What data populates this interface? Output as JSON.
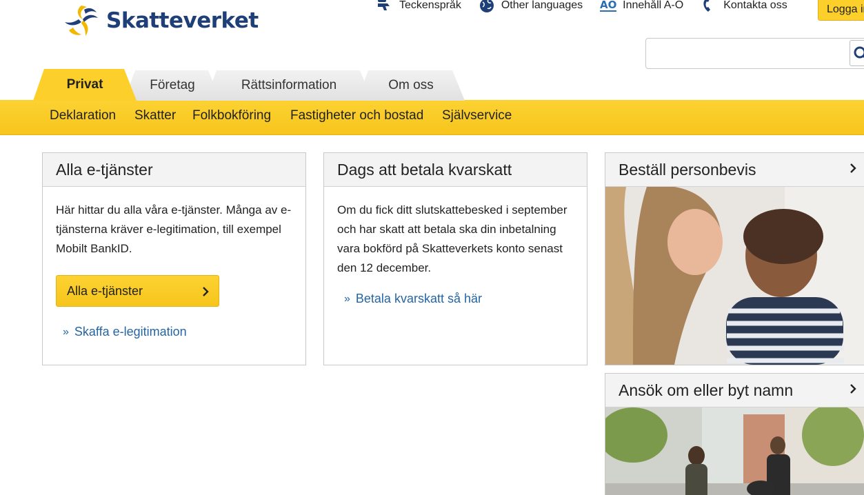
{
  "brand": {
    "name": "Skatteverket"
  },
  "toplinks": [
    {
      "label": "Teckenspråk",
      "icon": "sign-language-icon"
    },
    {
      "label": "Other languages",
      "icon": "globe-icon"
    },
    {
      "label": "Innehåll A-Ö",
      "icon": "a-o-icon"
    },
    {
      "label": "Kontakta oss",
      "icon": "phone-icon"
    }
  ],
  "login": {
    "label": "Logga in"
  },
  "search": {
    "placeholder": ""
  },
  "tabs": [
    {
      "label": "Privat",
      "active": true
    },
    {
      "label": "Företag",
      "active": false
    },
    {
      "label": "Rättsinformation",
      "active": false
    },
    {
      "label": "Om oss",
      "active": false
    }
  ],
  "subnav": [
    "Deklaration",
    "Skatter",
    "Folkbokföring",
    "Fastigheter och bostad",
    "Självservice"
  ],
  "cards": {
    "etjanster": {
      "title": "Alla e-tjänster",
      "body": "Här hittar du alla våra e-tjänster. Många av e-tjänsterna kräver e-legitimation, till exempel Mobilt BankID.",
      "button": "Alla e-tjänster",
      "link": "Skaffa e-legitimation"
    },
    "kvarskatt": {
      "title": "Dags att betala kvarskatt",
      "body": "Om du fick ditt slutskattebesked i september och har skatt att betala ska din inbetalning vara bokförd på Skatteverkets konto senast den 12 december.",
      "link": "Betala kvarskatt så här"
    },
    "personbevis": {
      "title": "Beställ personbevis"
    },
    "namn": {
      "title": "Ansök om eller byt namn"
    }
  },
  "colors": {
    "accent": "#fccf2b",
    "brand": "#1f3f78",
    "link": "#2465a5"
  }
}
